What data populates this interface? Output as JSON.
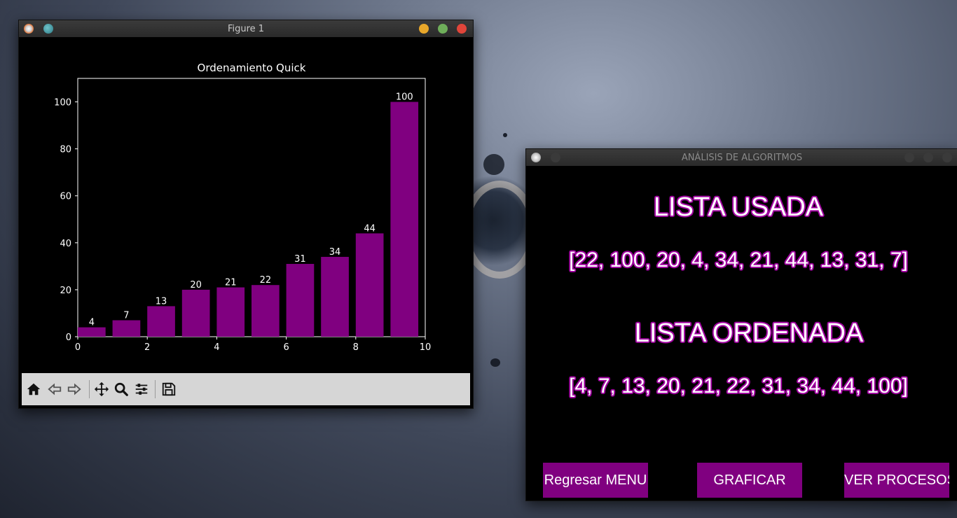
{
  "desktop": {
    "background": "#4a5366"
  },
  "figure_window": {
    "title": "Figure 1",
    "toolbar": {
      "tools": [
        "home-icon",
        "back-arrow-icon",
        "forward-arrow-icon",
        "pan-icon",
        "zoom-icon",
        "configure-subplots-icon",
        "save-icon"
      ]
    }
  },
  "chart_data": {
    "type": "bar",
    "title": "Ordenamiento Quick",
    "xlabel": "",
    "ylabel": "",
    "x": [
      0,
      1,
      2,
      3,
      4,
      5,
      6,
      7,
      8,
      9
    ],
    "values": [
      4,
      7,
      13,
      20,
      21,
      22,
      31,
      34,
      44,
      100
    ],
    "data_labels": [
      "4",
      "7",
      "13",
      "20",
      "21",
      "22",
      "31",
      "34",
      "44",
      "100"
    ],
    "xlim": [
      0,
      10
    ],
    "ylim": [
      0,
      110
    ],
    "xticks": [
      "0",
      "2",
      "4",
      "6",
      "8",
      "10"
    ],
    "yticks": [
      "0",
      "20",
      "40",
      "60",
      "80",
      "100"
    ],
    "bar_color": "#800080",
    "background": "#000000",
    "text_color": "#ffffff",
    "grid": false,
    "legend": "none"
  },
  "app_window": {
    "title": "ANÁLISIS DE ALGORITMOS",
    "heading_used": "LISTA USADA",
    "list_used": "[22, 100, 20, 4, 34, 21, 44, 13, 31, 7]",
    "heading_sorted": "LISTA ORDENADA",
    "list_sorted": "[4, 7, 13, 20, 21, 22, 31, 34, 44, 100]",
    "buttons": {
      "back": "Regresar MENU",
      "graph": "GRAFICAR",
      "process": "VER PROCESOS"
    },
    "accent_color": "#800080",
    "outline_color": "#a000a0"
  }
}
